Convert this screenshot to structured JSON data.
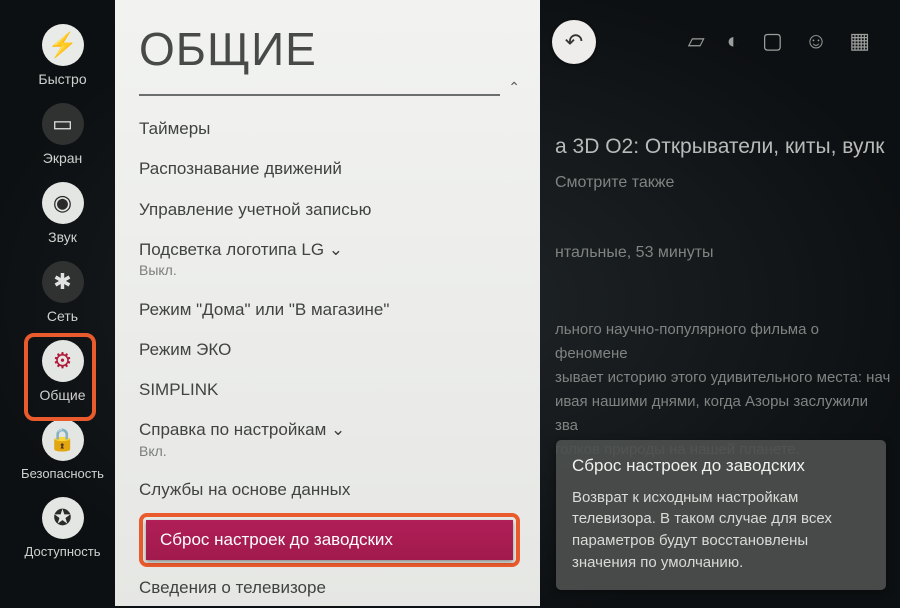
{
  "sidebar": {
    "items": [
      {
        "label": "Быстро",
        "icon": "⚡"
      },
      {
        "label": "Экран",
        "icon": "▭"
      },
      {
        "label": "Звук",
        "icon": "◉"
      },
      {
        "label": "Сеть",
        "icon": "✱"
      },
      {
        "label": "Общие",
        "icon": "⚙"
      },
      {
        "label": "Безопасность",
        "icon": "🔒"
      },
      {
        "label": "Доступность",
        "icon": "✪"
      }
    ]
  },
  "panel": {
    "title": "ОБЩИЕ",
    "menu": [
      {
        "label": "Таймеры"
      },
      {
        "label": "Распознавание движений"
      },
      {
        "label": "Управление учетной записью"
      },
      {
        "label": "Подсветка логотипа LG ⌄",
        "sub": "Выкл."
      },
      {
        "label": "Режим \"Дома\" или \"В магазине\""
      },
      {
        "label": "Режим ЭКО"
      },
      {
        "label": "SIMPLINK"
      },
      {
        "label": "Справка по настройкам ⌄",
        "sub": "Вкл."
      },
      {
        "label": "Службы на основе данных"
      },
      {
        "label": "Сброс настроек до заводских"
      },
      {
        "label": "Сведения о телевизоре"
      }
    ]
  },
  "background": {
    "headline": "а 3D O2: Открыватели, киты, вулк",
    "sub1": "Смотрите также",
    "sub2": "нтальные, 53 минуты",
    "descr": "льного научно-популярного фильма о феномене\nзывает историю этого удивительного места: нач\nивая нашими днями, когда Азоры заслужили зва\nголков природы на нашей планете."
  },
  "tooltip": {
    "title": "Сброс настроек до заводских",
    "body": "Возврат к исходным настройкам телевизора. В таком случае для всех параметров будут восстановлены значения по умолчанию."
  },
  "back": "↶"
}
